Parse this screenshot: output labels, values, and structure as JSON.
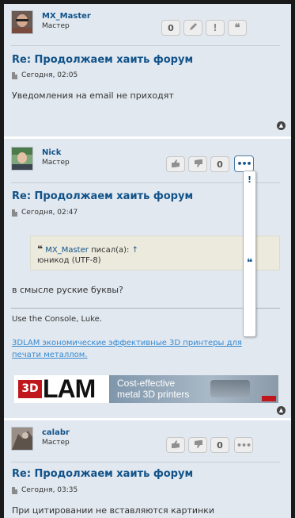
{
  "posts": [
    {
      "username": "MX_Master",
      "rank": "Мастер",
      "buttons": {
        "rating": "0"
      },
      "title": "Re: Продолжаем хаить форум",
      "date": "Сегодня, 02:05",
      "body": "Уведомления на email не приходят"
    },
    {
      "username": "Nick",
      "rank": "Мастер",
      "buttons": {
        "rating": "0"
      },
      "title": "Re: Продолжаем хаить форум",
      "date": "Сегодня, 02:47",
      "quote": {
        "author": "MX_Master",
        "wrote": "писал(а):",
        "arrow": "↑",
        "text": "юникод (UTF-8)"
      },
      "body": "в смысле руские буквы?",
      "signature": {
        "text": "Use the Console, Luke.",
        "link": "3DLAM экономические эффективные 3D принтеры для печати металлом.",
        "banner": {
          "logo_red": "3D",
          "logo_black": "LAM",
          "tagline_1": "Cost-effective",
          "tagline_2": "metal 3D printers"
        }
      }
    },
    {
      "username": "calabr",
      "rank": "Мастер",
      "buttons": {
        "rating": "0"
      },
      "title": "Re: Продолжаем хаить форум",
      "date": "Сегодня, 03:35",
      "body": "При цитировании не вставляются картинки"
    }
  ],
  "colors": {
    "link": "#105289",
    "background": "#e1e8ef",
    "quote_bg": "#ebeadd",
    "accent_red": "#c0171c"
  }
}
